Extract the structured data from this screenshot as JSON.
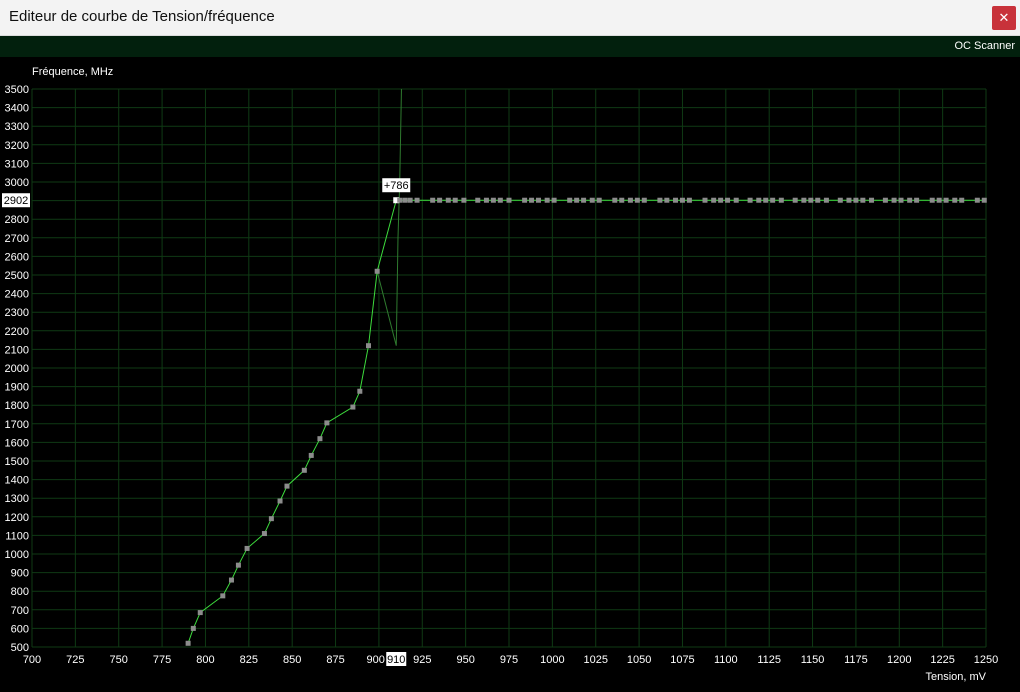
{
  "window": {
    "title": "Editeur de courbe de Tension/fréquence",
    "close_glyph": "✕"
  },
  "toolbar": {
    "oc_scanner_label": "OC Scanner"
  },
  "chart_data": {
    "type": "line",
    "ylabel": "Fréquence, MHz",
    "xlabel": "Tension, mV",
    "xlim": [
      700,
      1250
    ],
    "ylim": [
      500,
      3500
    ],
    "x_ticks": [
      700,
      725,
      750,
      775,
      800,
      825,
      850,
      875,
      900,
      925,
      950,
      975,
      1000,
      1025,
      1050,
      1075,
      1100,
      1125,
      1150,
      1175,
      1200,
      1225,
      1250
    ],
    "y_ticks": [
      500,
      600,
      700,
      800,
      900,
      1000,
      1100,
      1200,
      1300,
      1400,
      1500,
      1600,
      1700,
      1800,
      1900,
      2000,
      2100,
      2200,
      2300,
      2400,
      2500,
      2600,
      2700,
      2800,
      2900,
      3000,
      3100,
      3200,
      3300,
      3400,
      3500
    ],
    "grid": true,
    "colors": {
      "curve": "#3ddc3d",
      "points": "#8c8c8c",
      "selected_point": "#ffffff",
      "grid": "#0f3a14",
      "secondary_curve": "#2f7a2f"
    },
    "selected": {
      "x": 910,
      "y": 2902,
      "offset_label": "+786",
      "x_label": "910",
      "y_label": "2902"
    },
    "series": [
      {
        "points": [
          [
            790,
            520
          ],
          [
            793,
            600
          ],
          [
            797,
            685
          ],
          [
            810,
            775
          ],
          [
            815,
            860
          ],
          [
            819,
            940
          ],
          [
            824,
            1030
          ],
          [
            834,
            1110
          ],
          [
            838,
            1190
          ],
          [
            843,
            1285
          ],
          [
            847,
            1365
          ],
          [
            857,
            1450
          ],
          [
            861,
            1530
          ],
          [
            866,
            1620
          ],
          [
            870,
            1705
          ],
          [
            885,
            1790
          ],
          [
            889,
            1875
          ],
          [
            894,
            2120
          ],
          [
            899,
            2520
          ],
          [
            910,
            2902
          ],
          [
            912,
            2902
          ],
          [
            915,
            2902
          ],
          [
            918,
            2902
          ],
          [
            922,
            2902
          ],
          [
            931,
            2902
          ],
          [
            935,
            2902
          ],
          [
            940,
            2902
          ],
          [
            944,
            2902
          ],
          [
            949,
            2902
          ],
          [
            957,
            2902
          ],
          [
            962,
            2902
          ],
          [
            966,
            2902
          ],
          [
            970,
            2902
          ],
          [
            975,
            2902
          ],
          [
            984,
            2902
          ],
          [
            988,
            2902
          ],
          [
            992,
            2902
          ],
          [
            997,
            2902
          ],
          [
            1001,
            2902
          ],
          [
            1010,
            2902
          ],
          [
            1014,
            2902
          ],
          [
            1018,
            2902
          ],
          [
            1023,
            2902
          ],
          [
            1027,
            2902
          ],
          [
            1036,
            2902
          ],
          [
            1040,
            2902
          ],
          [
            1045,
            2902
          ],
          [
            1049,
            2902
          ],
          [
            1053,
            2902
          ],
          [
            1062,
            2902
          ],
          [
            1066,
            2902
          ],
          [
            1071,
            2902
          ],
          [
            1075,
            2902
          ],
          [
            1079,
            2902
          ],
          [
            1088,
            2902
          ],
          [
            1093,
            2902
          ],
          [
            1097,
            2902
          ],
          [
            1101,
            2902
          ],
          [
            1106,
            2902
          ],
          [
            1114,
            2902
          ],
          [
            1119,
            2902
          ],
          [
            1123,
            2902
          ],
          [
            1127,
            2902
          ],
          [
            1132,
            2902
          ],
          [
            1140,
            2902
          ],
          [
            1145,
            2902
          ],
          [
            1149,
            2902
          ],
          [
            1153,
            2902
          ],
          [
            1158,
            2902
          ],
          [
            1166,
            2902
          ],
          [
            1171,
            2902
          ],
          [
            1175,
            2902
          ],
          [
            1179,
            2902
          ],
          [
            1184,
            2902
          ],
          [
            1192,
            2902
          ],
          [
            1197,
            2902
          ],
          [
            1201,
            2902
          ],
          [
            1206,
            2902
          ],
          [
            1210,
            2902
          ],
          [
            1219,
            2902
          ],
          [
            1223,
            2902
          ],
          [
            1227,
            2902
          ],
          [
            1232,
            2902
          ],
          [
            1236,
            2902
          ],
          [
            1245,
            2902
          ],
          [
            1249,
            2902
          ]
        ]
      },
      {
        "style": "secondary",
        "points": [
          [
            899,
            2520
          ],
          [
            910,
            2120
          ],
          [
            911,
            2700
          ],
          [
            912,
            3000
          ],
          [
            913,
            3500
          ]
        ]
      }
    ]
  }
}
